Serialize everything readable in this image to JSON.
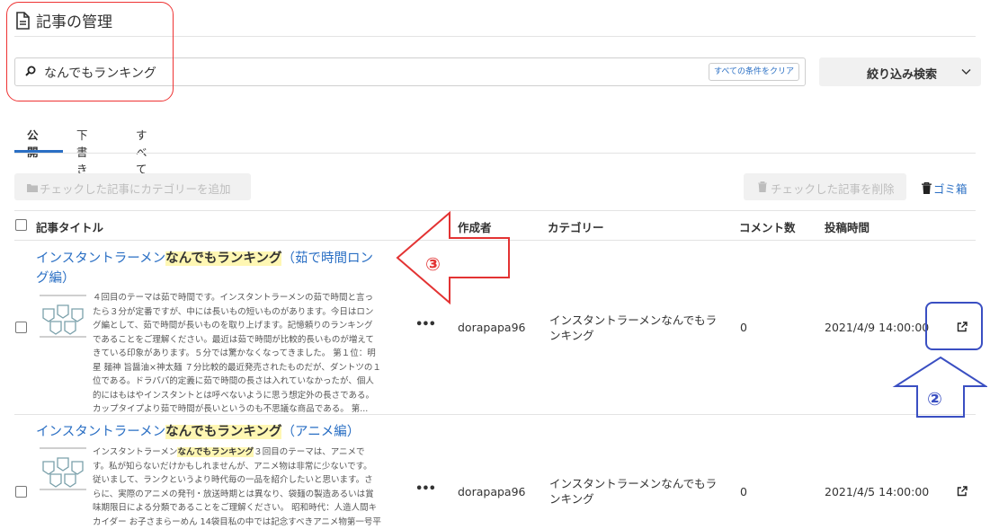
{
  "page": {
    "title": "記事の管理",
    "search_value": "なんでもランキング",
    "clear_button": "すべての条件をクリア",
    "filter_button": "絞り込み検索"
  },
  "tabs": [
    "公開",
    "下書き",
    "すべて"
  ],
  "toolbar": {
    "add_category": "チェックした記事にカテゴリーを追加",
    "delete_checked": "チェックした記事を削除",
    "trash": "ゴミ箱"
  },
  "table": {
    "headers": {
      "title": "記事タイトル",
      "author": "作成者",
      "category": "カテゴリー",
      "comments": "コメント数",
      "date": "投稿時間"
    },
    "rows": [
      {
        "title_pre": "インスタントラーメン",
        "title_hl": "なんでもランキング",
        "title_post_1": "（茹で時間ロン",
        "title_post_2": "グ編）",
        "excerpt": [
          "４回目のテーマは茹で時間です。インスタントラーメンの茹で時間と言っ",
          "たら３分が定番ですが、中には長いもの短いものがあります。今日はロン",
          "グ編として、茹で時間が長いものを取り上げます。記憶頼りのランキング",
          "であることをご理解ください。最近は茹で時間が比較的長いものが増えて",
          "きている印象があります。５分では驚かなくなってきました。 第１位：明",
          "星 麺神 旨醤油×神太麺 ７分比較的最近発売されたものだが、ダントツの１",
          "位である。ドラパパ的定義に茹で時間の長さは入れていなかったが、個人",
          "的にはもはやインスタントとは呼べないように思う想定外の長さである。",
          "カップタイプより茹で時間が長いというのも不思議な商品である。 第..."
        ],
        "author": "dorapapa96",
        "category_1": "インスタントラーメンなんでもラ",
        "category_2": "ンキング",
        "comments": "0",
        "date": "2021/4/9 14:00:00"
      },
      {
        "title_pre": "インスタントラーメン",
        "title_hl": "なんでもランキング",
        "title_post_1": "（アニメ編）",
        "excerpt_hl_pre": "インスタントラーメン",
        "excerpt_hl": "なんでもランキング",
        "excerpt_hl_post": "３回目のテーマは、アニメで",
        "excerpt": [
          "す。私が知らないだけかもしれませんが、アニメ物は非常に少ないです。",
          "従いまして、ランクというより時代毎の一品を紹介したいと思います。さ",
          "らに、実際のアニメの発刊・放送時期とは異なり、袋麺の製造あるいは賞",
          "味期限日による分類であることをご理解ください。 昭和時代：人造人間キ",
          "カイダー お子さまらーめん 14袋目私の中では記念すべきアニメ物第一号平"
        ],
        "author": "dorapapa96",
        "category_1": "インスタントラーメンなんでもラ",
        "category_2": "ンキング",
        "comments": "0",
        "date": "2021/4/5 14:00:00"
      }
    ]
  },
  "annotations": {
    "three": "③",
    "two": "②"
  },
  "colors": {
    "accent": "#2a6fc4",
    "highlight": "#fff7b3",
    "red_annotation": "#e33333",
    "blue_annotation": "#3a4fc2"
  }
}
